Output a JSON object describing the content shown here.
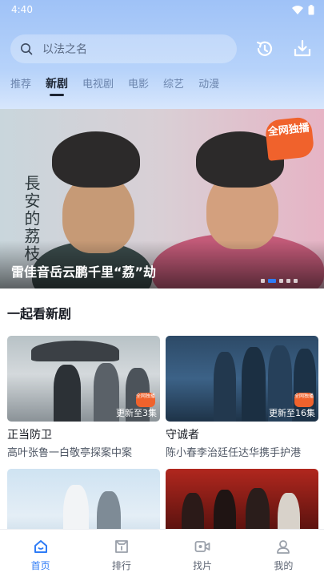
{
  "status_bar": {
    "time": "4:40"
  },
  "search": {
    "placeholder": "以法之名"
  },
  "tabs": [
    {
      "label": "推荐",
      "active": false
    },
    {
      "label": "新剧",
      "active": true
    },
    {
      "label": "电视剧",
      "active": false
    },
    {
      "label": "电影",
      "active": false
    },
    {
      "label": "综艺",
      "active": false
    },
    {
      "label": "动漫",
      "active": false
    }
  ],
  "banner": {
    "title": "雷佳音岳云鹏千里“荔”劫",
    "calligraphy": "長安的荔枝",
    "badge": "全网独播",
    "slide_count": 5,
    "active_slide": 2
  },
  "section": {
    "title": "一起看新剧",
    "cards": [
      {
        "title": "正当防卫",
        "subtitle": "高叶张鲁一白敬亭探案中案",
        "episodes": "更新至3集",
        "badge": "全网独播"
      },
      {
        "title": "守诚者",
        "subtitle": "陈小春李治廷任达华携手护港",
        "episodes": "更新至16集",
        "badge": "全网独播"
      },
      {
        "title": "",
        "subtitle": "",
        "episodes": ""
      },
      {
        "title": "",
        "subtitle": "",
        "episodes": ""
      }
    ]
  },
  "bottom_nav": [
    {
      "label": "首页",
      "icon": "home-icon",
      "active": true
    },
    {
      "label": "排行",
      "icon": "ranking-icon",
      "active": false
    },
    {
      "label": "找片",
      "icon": "video-icon",
      "active": false
    },
    {
      "label": "我的",
      "icon": "profile-icon",
      "active": false
    }
  ],
  "colors": {
    "accent": "#2f7cf6",
    "badge": "#f0622c"
  }
}
